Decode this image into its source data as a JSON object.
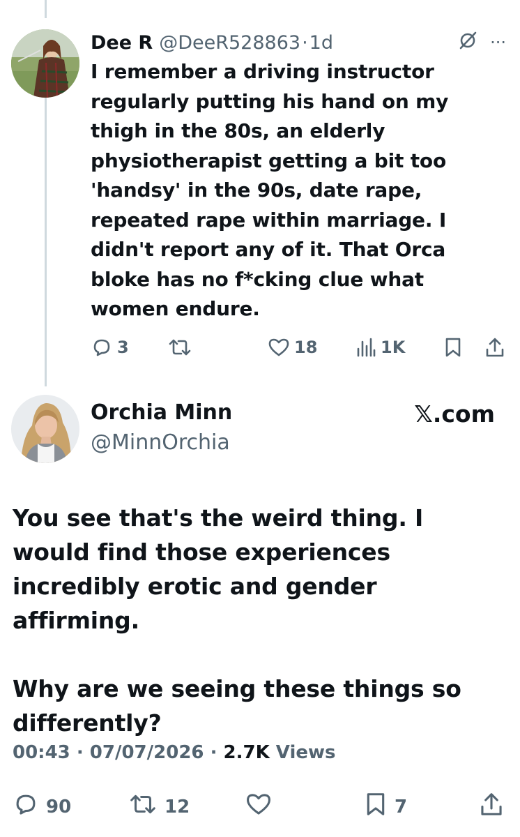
{
  "reply": {
    "name": "Dee R",
    "handle": "@DeeR528863",
    "time_sep": "·",
    "age": "1d",
    "text": "I remember a driving instructor regularly putting his hand on my thigh in the 80s, an elderly physiotherapist getting a bit too 'handsy' in the 90s, date rape, repeated rape within marriage. I didn't report any of it. That Orca bloke has no f*cking clue what women endure.",
    "more": "···",
    "actions": {
      "replies": "3",
      "reposts": "",
      "likes": "18",
      "views": "1K"
    }
  },
  "tweet": {
    "name": "Orchia Minn",
    "handle": "@MinnOrchia",
    "watermark": "𝕏.com",
    "paragraphs": [
      "You see that's the weird thing.  I would find those experiences incredibly erotic and gender affirming.",
      "Why are we seeing these things so differently?"
    ],
    "time": "00:43",
    "date": "07/07/2026",
    "sep": "·",
    "views_count": "2.7K",
    "views_label": "Views",
    "actions": {
      "replies": "90",
      "reposts": "12",
      "likes": "",
      "bookmarks": "7"
    }
  },
  "colors": {
    "text": "#0f1419",
    "muted": "#536471",
    "thread_line": "#cfd9de"
  }
}
